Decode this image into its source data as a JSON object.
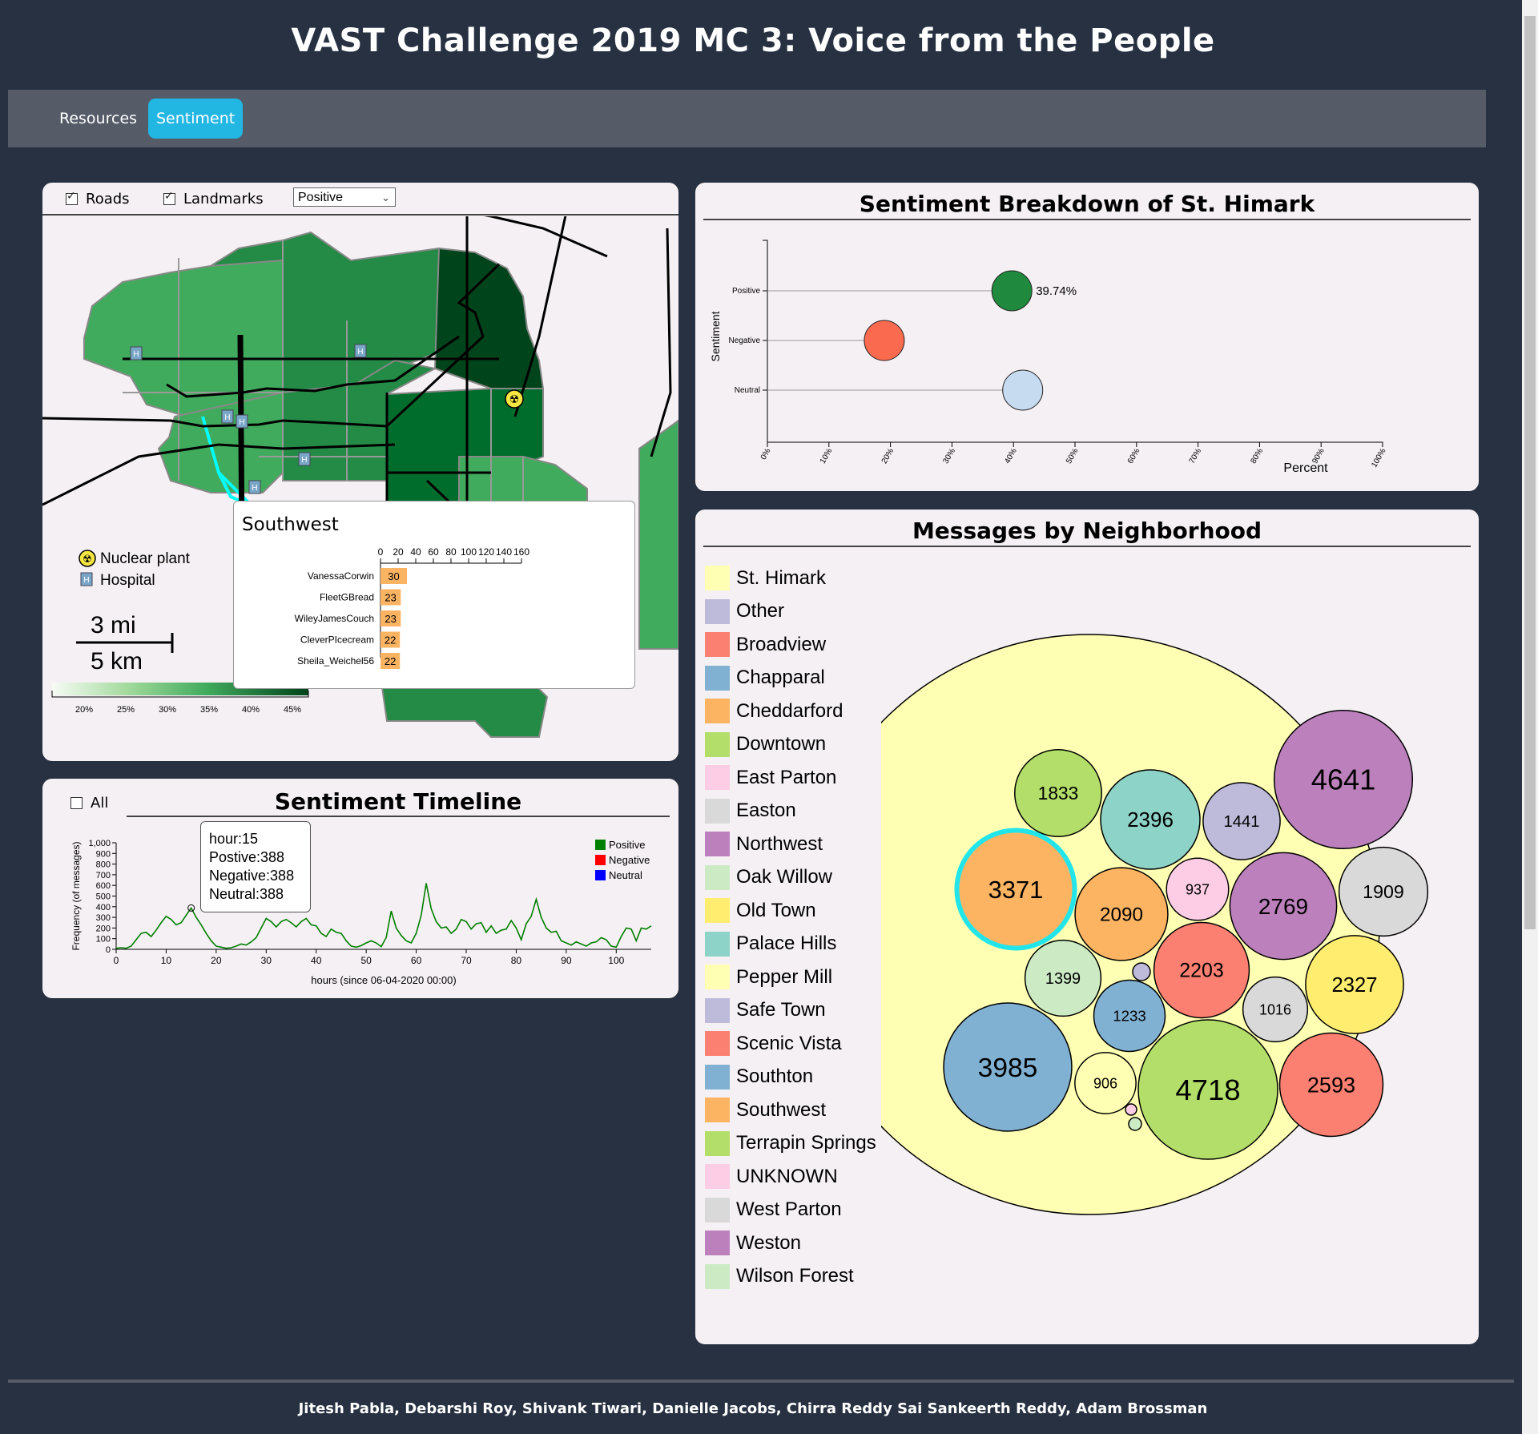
{
  "app": {
    "title": "VAST Challenge 2019 MC 3: Voice from the People"
  },
  "nav": {
    "tabs": [
      {
        "label": "Resources",
        "active": false
      },
      {
        "label": "Sentiment",
        "active": true
      }
    ]
  },
  "map_panel": {
    "controls": {
      "roads_label": "Roads",
      "roads_checked": true,
      "landmarks_label": "Landmarks",
      "landmarks_checked": true,
      "sentiment_select": "Positive"
    },
    "legend": {
      "nuclear_label": "Nuclear plant",
      "hospital_label": "Hospital"
    },
    "scale": {
      "miles": "3 mi",
      "km": "5 km"
    },
    "color_scale_labels": [
      "20%",
      "25%",
      "30%",
      "35%",
      "40%",
      "45%"
    ],
    "tooltip": {
      "title": "Southwest",
      "axis_ticks": [
        "0",
        "20",
        "40",
        "60",
        "80",
        "100",
        "120",
        "140",
        "160"
      ],
      "bars": [
        {
          "user": "VanessaCorwin",
          "value": 30
        },
        {
          "user": "FleetGBread",
          "value": 23
        },
        {
          "user": "WileyJamesCouch",
          "value": 23
        },
        {
          "user": "CleverPIcecream",
          "value": 22
        },
        {
          "user": "Sheila_Weichel56",
          "value": 22
        }
      ]
    }
  },
  "timeline_panel": {
    "title": "Sentiment Timeline",
    "all_label": "All",
    "all_checked": false,
    "ylabel": "Frequency (of messages)",
    "xlabel": "hours (since 06-04-2020 00:00)",
    "legend": [
      {
        "label": "Positive",
        "color": "#008000"
      },
      {
        "label": "Negative",
        "color": "#ff0000"
      },
      {
        "label": "Neutral",
        "color": "#0000ff"
      }
    ],
    "tooltip": {
      "hour": "hour:15",
      "positive": "Postive:388",
      "negative": "Negative:388",
      "neutral": "Neutral:388"
    }
  },
  "sentiment_panel": {
    "title": "Sentiment Breakdown of St. Himark",
    "value_label": "39.74%"
  },
  "neighborhood_panel": {
    "title": "Messages by Neighborhood",
    "legend": [
      {
        "label": "St. Himark",
        "color": "#ffffb3"
      },
      {
        "label": "Other",
        "color": "#bebada"
      },
      {
        "label": "Broadview",
        "color": "#fb8072"
      },
      {
        "label": "Chapparal",
        "color": "#80b1d3"
      },
      {
        "label": "Cheddarford",
        "color": "#fdb462"
      },
      {
        "label": "Downtown",
        "color": "#b3de69"
      },
      {
        "label": "East Parton",
        "color": "#fccde5"
      },
      {
        "label": "Easton",
        "color": "#d9d9d9"
      },
      {
        "label": "Northwest",
        "color": "#bc80bd"
      },
      {
        "label": "Oak Willow",
        "color": "#ccebc5"
      },
      {
        "label": "Old Town",
        "color": "#ffed6f"
      },
      {
        "label": "Palace Hills",
        "color": "#8dd3c7"
      },
      {
        "label": "Pepper Mill",
        "color": "#ffffb3"
      },
      {
        "label": "Safe Town",
        "color": "#bebada"
      },
      {
        "label": "Scenic Vista",
        "color": "#fb8072"
      },
      {
        "label": "Southton",
        "color": "#80b1d3"
      },
      {
        "label": "Southwest",
        "color": "#fdb462"
      },
      {
        "label": "Terrapin Springs",
        "color": "#b3de69"
      },
      {
        "label": "UNKNOWN",
        "color": "#fccde5"
      },
      {
        "label": "West Parton",
        "color": "#d9d9d9"
      },
      {
        "label": "Weston",
        "color": "#bc80bd"
      },
      {
        "label": "Wilson Forest",
        "color": "#ccebc5"
      }
    ]
  },
  "chart_data": [
    {
      "type": "scatter",
      "title": "Sentiment Breakdown of St. Himark",
      "xlabel": "Percent",
      "ylabel": "Sentiment",
      "xlim": [
        0,
        100
      ],
      "x_ticks": [
        "0%",
        "10%",
        "20%",
        "30%",
        "40%",
        "50%",
        "60%",
        "70%",
        "80%",
        "90%",
        "100%"
      ],
      "categories": [
        "Positive",
        "Negative",
        "Neutral"
      ],
      "values": [
        39.74,
        19,
        41.5
      ],
      "colors": [
        "#1f8a3e",
        "#f96a4f",
        "#c6dbef"
      ]
    },
    {
      "type": "line",
      "title": "Sentiment Timeline",
      "xlabel": "hours (since 06-04-2020 00:00)",
      "ylabel": "Frequency (of messages)",
      "xlim": [
        0,
        107
      ],
      "ylim": [
        0,
        1000
      ],
      "x_ticks": [
        0,
        10,
        20,
        30,
        40,
        50,
        60,
        70,
        80,
        90,
        100
      ],
      "y_ticks": [
        0,
        100,
        200,
        300,
        400,
        500,
        600,
        700,
        800,
        900,
        1000
      ],
      "series": [
        {
          "name": "Positive",
          "color": "#008000",
          "x": [
            0,
            1,
            2,
            3,
            4,
            5,
            6,
            7,
            8,
            9,
            10,
            11,
            12,
            13,
            14,
            15,
            16,
            17,
            18,
            19,
            20,
            21,
            22,
            23,
            24,
            25,
            26,
            27,
            28,
            29,
            30,
            31,
            32,
            33,
            34,
            35,
            36,
            37,
            38,
            39,
            40,
            41,
            42,
            43,
            44,
            45,
            46,
            47,
            48,
            49,
            50,
            51,
            52,
            53,
            54,
            55,
            56,
            57,
            58,
            59,
            60,
            61,
            62,
            63,
            64,
            65,
            66,
            67,
            68,
            69,
            70,
            71,
            72,
            73,
            74,
            75,
            76,
            77,
            78,
            79,
            80,
            81,
            82,
            83,
            84,
            85,
            86,
            87,
            88,
            89,
            90,
            91,
            92,
            93,
            94,
            95,
            96,
            97,
            98,
            99,
            100,
            101,
            102,
            103,
            104,
            105,
            106,
            107
          ],
          "y": [
            10,
            15,
            10,
            30,
            90,
            150,
            160,
            120,
            180,
            250,
            310,
            280,
            230,
            250,
            320,
            388,
            300,
            230,
            150,
            80,
            30,
            20,
            10,
            15,
            30,
            50,
            40,
            70,
            110,
            200,
            290,
            260,
            210,
            260,
            280,
            250,
            210,
            260,
            290,
            230,
            220,
            150,
            120,
            190,
            160,
            150,
            80,
            30,
            20,
            35,
            60,
            80,
            60,
            25,
            110,
            360,
            200,
            130,
            80,
            60,
            150,
            320,
            620,
            380,
            260,
            200,
            210,
            150,
            190,
            280,
            260,
            190,
            240,
            250,
            160,
            220,
            150,
            180,
            190,
            270,
            200,
            90,
            240,
            310,
            470,
            300,
            200,
            160,
            170,
            80,
            60,
            40,
            70,
            50,
            30,
            60,
            70,
            110,
            90,
            30,
            20,
            120,
            200,
            190,
            80,
            200,
            190,
            220
          ]
        }
      ]
    },
    {
      "type": "bar",
      "title": "Southwest",
      "categories": [
        "VanessaCorwin",
        "FleetGBread",
        "WileyJamesCouch",
        "CleverPIcecream",
        "Sheila_Weichel56"
      ],
      "values": [
        30,
        23,
        23,
        22,
        22
      ],
      "xlim": [
        0,
        160
      ]
    },
    {
      "type": "bubble",
      "title": "Messages by Neighborhood",
      "series": [
        {
          "name": "Terrapin Springs",
          "value": 4718,
          "color": "#b3de69"
        },
        {
          "name": "Weston",
          "value": 4641,
          "color": "#bc80bd"
        },
        {
          "name": "Chapparal",
          "value": 3985,
          "color": "#80b1d3"
        },
        {
          "name": "Southwest",
          "value": 3371,
          "color": "#fdb462"
        },
        {
          "name": "Northwest",
          "value": 2769,
          "color": "#bc80bd"
        },
        {
          "name": "Scenic Vista",
          "value": 2593,
          "color": "#fb8072"
        },
        {
          "name": "Palace Hills",
          "value": 2396,
          "color": "#8dd3c7"
        },
        {
          "name": "Old Town",
          "value": 2327,
          "color": "#ffed6f"
        },
        {
          "name": "Broadview",
          "value": 2203,
          "color": "#fb8072"
        },
        {
          "name": "Cheddarford",
          "value": 2090,
          "color": "#fdb462"
        },
        {
          "name": "Easton",
          "value": 1909,
          "color": "#d9d9d9"
        },
        {
          "name": "Downtown",
          "value": 1833,
          "color": "#b3de69"
        },
        {
          "name": "Safe Town",
          "value": 1441,
          "color": "#bebada"
        },
        {
          "name": "Oak Willow",
          "value": 1399,
          "color": "#ccebc5"
        },
        {
          "name": "Southton",
          "value": 1233,
          "color": "#80b1d3"
        },
        {
          "name": "West Parton",
          "value": 1016,
          "color": "#d9d9d9"
        },
        {
          "name": "East Parton",
          "value": 937,
          "color": "#fccde5"
        },
        {
          "name": "Pepper Mill",
          "value": 906,
          "color": "#ffffb3"
        }
      ]
    }
  ],
  "footer": {
    "authors": "Jitesh Pabla, Debarshi Roy, Shivank Tiwari, Danielle Jacobs, Chirra Reddy Sai Sankeerth Reddy, Adam Brossman"
  }
}
